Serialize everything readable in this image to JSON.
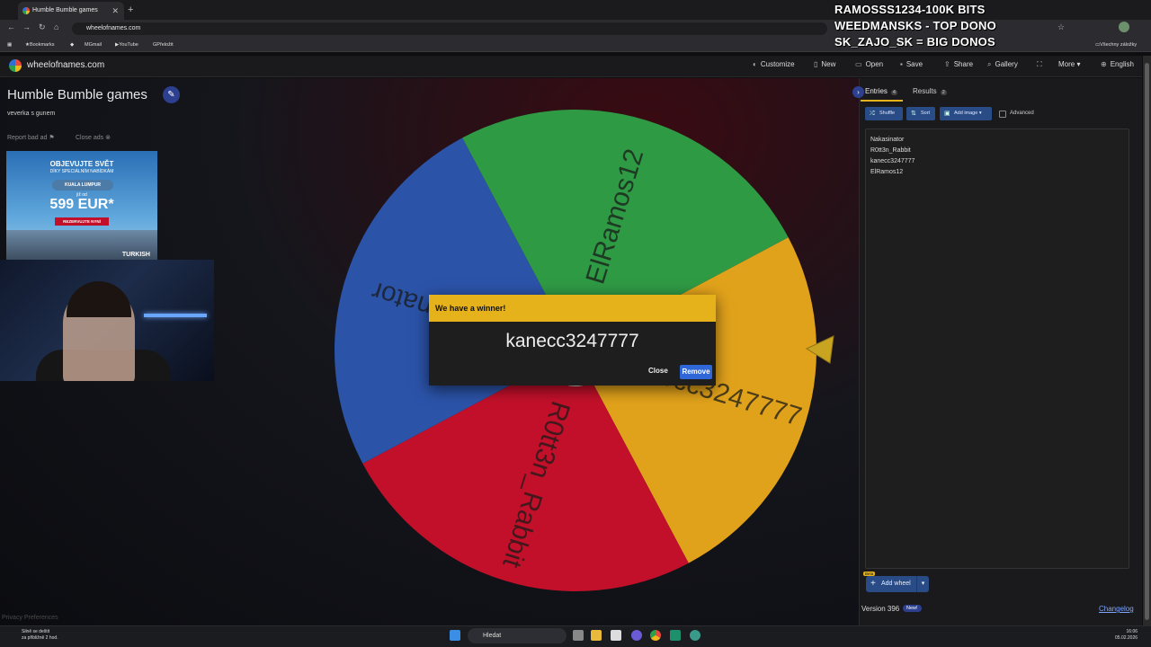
{
  "browser": {
    "tab_title": "Humble Bumble games",
    "url": "wheelofnames.com",
    "bookmarks": [
      "Bookmarks",
      "Gmail",
      "YouTube",
      "Přeložit"
    ],
    "all_bookmarks": "Všechny záložky"
  },
  "overlay": [
    "RAMOSSS1234-100K BITS",
    "WEEDMANSKS - TOP DONO",
    "SK_ZAJO_SK = BIG DONOS"
  ],
  "app": {
    "site_name": "wheelofnames.com",
    "menu": [
      "Customize",
      "New",
      "Open",
      "Save",
      "Share",
      "Gallery",
      "More",
      "English"
    ],
    "title": "Humble Bumble games",
    "description": "veverka s gunem",
    "report_ad": "Report bad ad",
    "close_ads": "Close ads",
    "privacy": "Privacy Preferences"
  },
  "ad": {
    "line1": "OBJEVUJTE SVĚT",
    "line2": "DÍKY SPECIÁLNÍM NABÍDKÁM",
    "destination": "KUALA LUMPUR",
    "from": "již od",
    "price": "599 EUR*",
    "cta": "REZERVUJTE NYNÍ",
    "brand": "TURKISH"
  },
  "wheel": {
    "segments": [
      {
        "label": "kanecc3247777",
        "color": "#e1a21b"
      },
      {
        "label": "R0tt3n_Rabbit",
        "color": "#c3102a"
      },
      {
        "label": "Nakasinator",
        "color": "#2b53a8"
      },
      {
        "label": "ElRamos12",
        "color": "#2f9a44"
      }
    ]
  },
  "dialog": {
    "header": "We have a winner!",
    "winner": "kanecc3247777",
    "close": "Close",
    "remove": "Remove"
  },
  "panel": {
    "tab_entries": "Entries",
    "entries_count": "4",
    "tab_results": "Results",
    "results_count": "2",
    "shuffle": "Shuffle",
    "sort": "Sort",
    "add_image": "Add image",
    "advanced": "Advanced",
    "entries": [
      "Nakasinator",
      "R0tt3n_Rabbit",
      "kanecc3247777",
      "ElRamos12"
    ],
    "beta": "Beta",
    "add_wheel": "Add wheel",
    "version": "Version 396",
    "new_badge": "New!",
    "changelog": "Changelog"
  },
  "taskbar": {
    "weather_line1": "Silně se deštit",
    "weather_line2": "za přibližně 2 hod.",
    "search": "Hledat",
    "time": "16:06",
    "date": "05.02.2026"
  }
}
